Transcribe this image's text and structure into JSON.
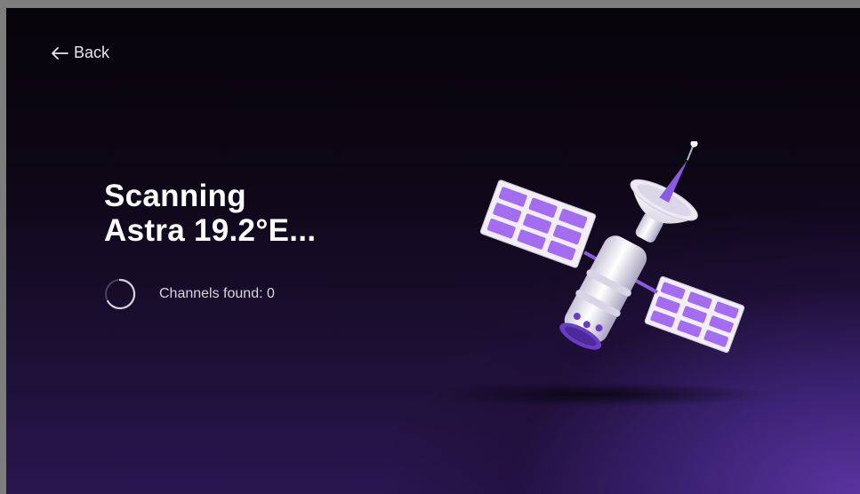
{
  "nav": {
    "back_label": "Back"
  },
  "scan": {
    "title_line1": "Scanning",
    "title_line2": "Astra 19.2°E...",
    "channels_label": "Channels found: 0"
  },
  "icons": {
    "back": "arrow-left-icon",
    "spinner": "loading-spinner-icon",
    "illustration": "satellite-illustration"
  },
  "colors": {
    "background_dark": "#07040b",
    "background_accent": "#5b34a0",
    "solar_panel": "#a46cf0",
    "text_primary": "#ffffff"
  }
}
